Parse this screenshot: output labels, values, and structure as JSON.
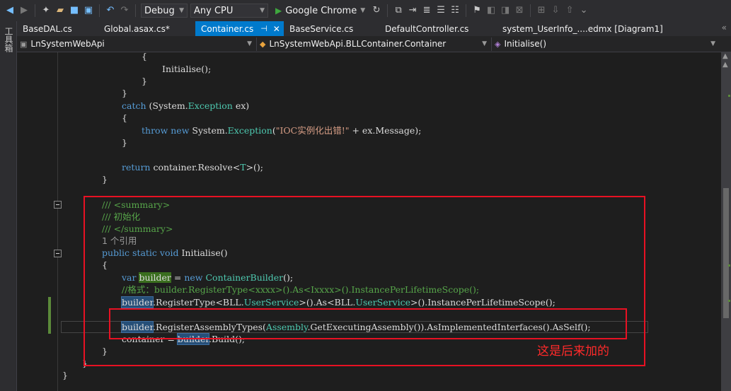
{
  "toolbar": {
    "config": "Debug",
    "platform": "Any CPU",
    "run_target": "Google Chrome"
  },
  "leftbar": {
    "label": "工具箱"
  },
  "tabs": [
    {
      "label": "BaseDAL.cs"
    },
    {
      "label": "Global.asax.cs*"
    },
    {
      "label": "Container.cs"
    },
    {
      "label": "BaseService.cs"
    },
    {
      "label": "DefaultController.cs"
    },
    {
      "label": "system_UserInfo_....edmx [Diagram1]"
    }
  ],
  "navbar": {
    "project": "LnSystemWebApi",
    "type": "LnSystemWebApi.BLLContainer.Container",
    "member": "Initialise()"
  },
  "code": {
    "l1": "{",
    "l2": "Initialise();",
    "l3": "}",
    "l4": "}",
    "l5_kw": "catch",
    "l5_a": " (System.",
    "l5_ty": "Exception",
    "l5_b": " ex)",
    "l6": "{",
    "l7_kw1": "throw",
    "l7_kw2": " new",
    "l7_a": " System.",
    "l7_ty": "Exception",
    "l7_b": "(",
    "l7_str": "\"IOC实例化出错!\"",
    "l7_c": " + ex.Message);",
    "l8": "}",
    "l9_kw": "return",
    "l9_a": " container.Resolve<",
    "l9_ty": "T",
    "l9_b": ">();",
    "l10": "}",
    "l11": "/// <summary>",
    "l12": "/// 初始化",
    "l13": "/// </summary>",
    "l14": "1 个引用",
    "l15_kw": "public static void",
    "l15_a": " Initialise()",
    "l16": "{",
    "l17_kw": "var",
    "l17_v": "builder",
    "l17_a": " = ",
    "l17_kw2": "new",
    "l17_ty": " ContainerBuilder",
    "l17_b": "();",
    "l18": "//格式：builder.RegisterType<xxxx>().As<Ixxxx>().InstancePerLifetimeScope();",
    "l19_v": "builder",
    "l19_a": ".RegisterType<BLL.",
    "l19_ty": "UserService",
    "l19_b": ">().As<BLL.",
    "l19_ty2": "UserService",
    "l19_c": ">().InstancePerLifetimeScope();",
    "l20_v": "builder",
    "l20_a": ".RegisterAssemblyTypes(",
    "l20_ty": "Assembly",
    "l20_b": ".GetExecutingAssembly()).AsImplementedInterfaces().AsSelf();",
    "l21_a": "container = ",
    "l21_v": "builder",
    "l21_b": ".Build();",
    "l22": "}",
    "l23": "}",
    "l24": "}"
  },
  "annotation": {
    "note": "这是后来加的"
  }
}
